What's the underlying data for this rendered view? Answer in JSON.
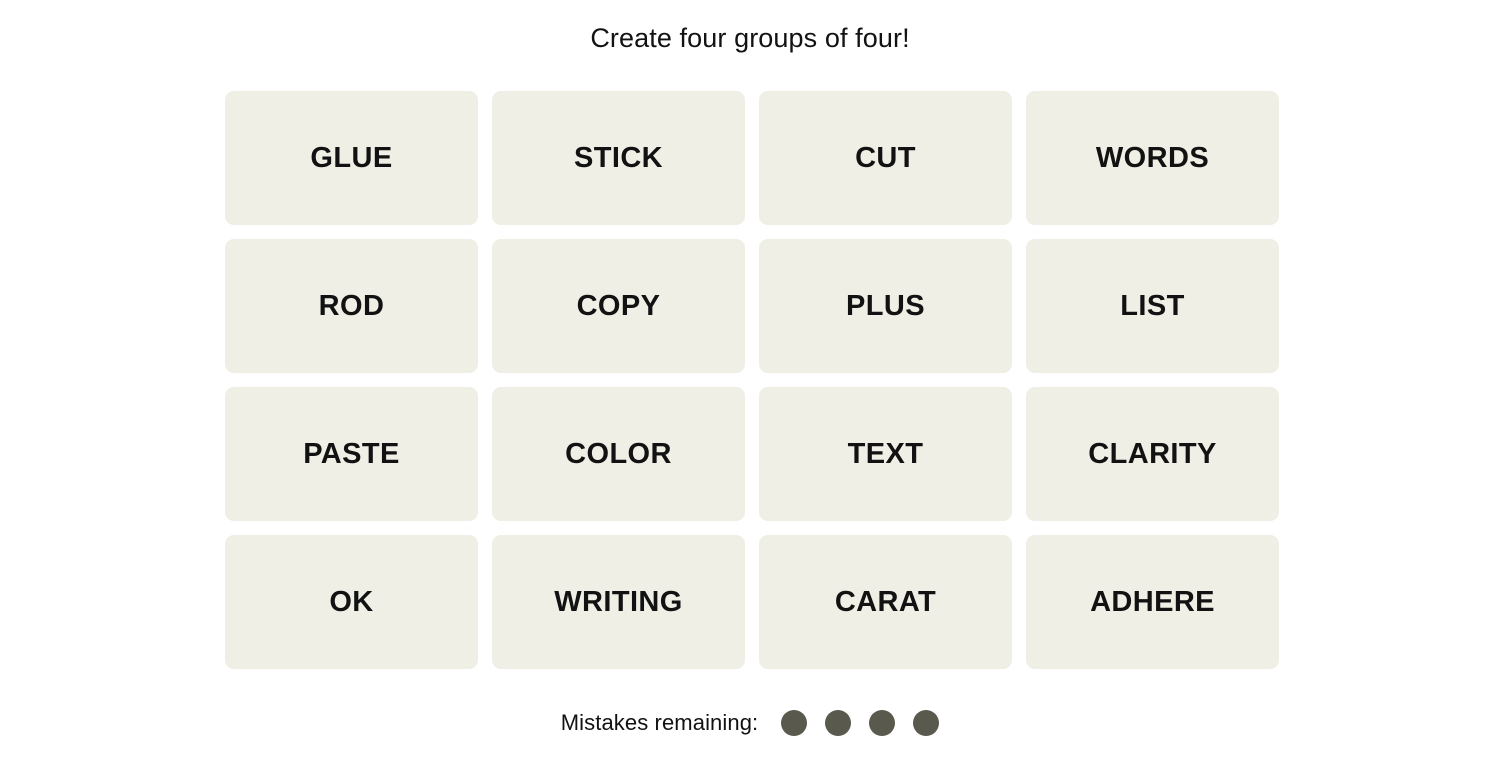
{
  "game": {
    "title": "Create four groups of four!",
    "board": {
      "tiles": [
        "GLUE",
        "STICK",
        "CUT",
        "WORDS",
        "ROD",
        "COPY",
        "PLUS",
        "LIST",
        "PASTE",
        "COLOR",
        "TEXT",
        "CLARITY",
        "OK",
        "WRITING",
        "CARAT",
        "ADHERE"
      ],
      "rows": 4,
      "columns": 4
    },
    "footer": {
      "mistakes_label": "Mistakes remaining:",
      "mistakes_remaining": 4,
      "dot_color": "#5a594e"
    },
    "colors": {
      "background": "#ffffff",
      "tile_fill": "#efefe6",
      "text": "#121213",
      "mistake_dot": "#5a594e"
    }
  }
}
